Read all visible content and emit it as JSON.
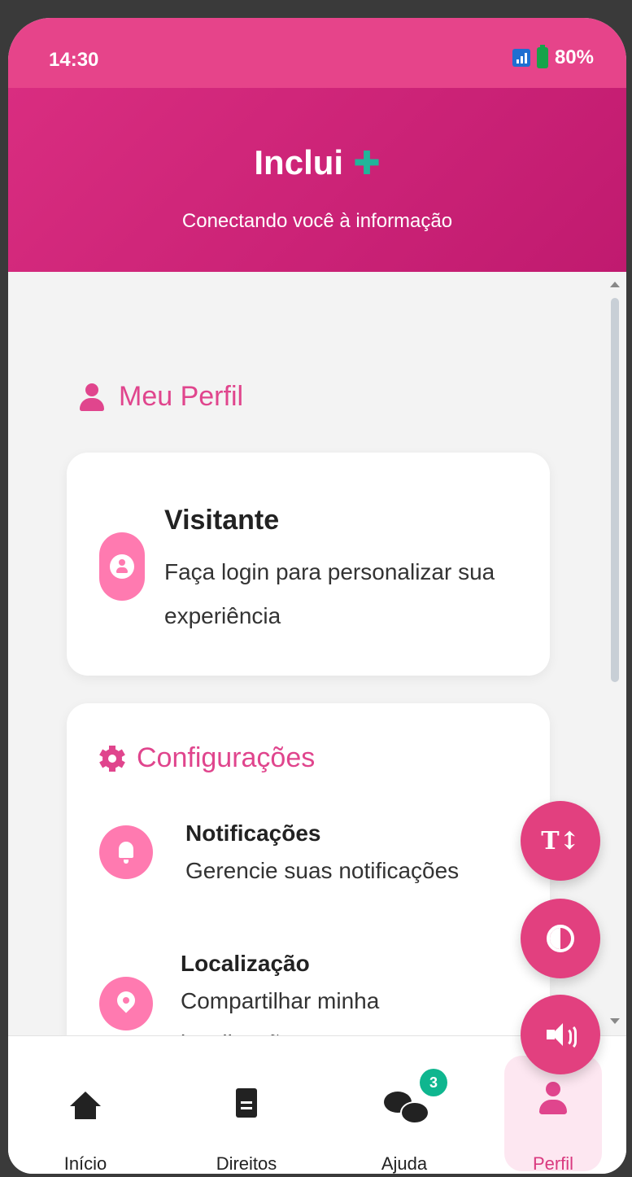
{
  "status_bar": {
    "time": "14:30",
    "battery": "80%"
  },
  "header": {
    "title": "Inclui",
    "subtitle": "Conectando você à informação"
  },
  "profile_section": {
    "title": "Meu Perfil"
  },
  "visitor_card": {
    "name": "Visitante",
    "description": "Faça login para personalizar sua experiência"
  },
  "settings": {
    "title": "Configurações",
    "items": [
      {
        "title": "Notificações",
        "description": "Gerencie suas notificações"
      },
      {
        "title": "Localização",
        "description": "Compartilhar minha localização"
      }
    ]
  },
  "fab": {
    "text_size_symbol": "T↕"
  },
  "bottom_nav": {
    "items": [
      {
        "label": "Início"
      },
      {
        "label": "Direitos"
      },
      {
        "label": "Ajuda",
        "badge": "3"
      },
      {
        "label": "Perfil"
      }
    ],
    "active": "Perfil"
  },
  "colors": {
    "primary": "#e0458d",
    "accent": "#21b59a",
    "badge": "#0fb68f"
  }
}
